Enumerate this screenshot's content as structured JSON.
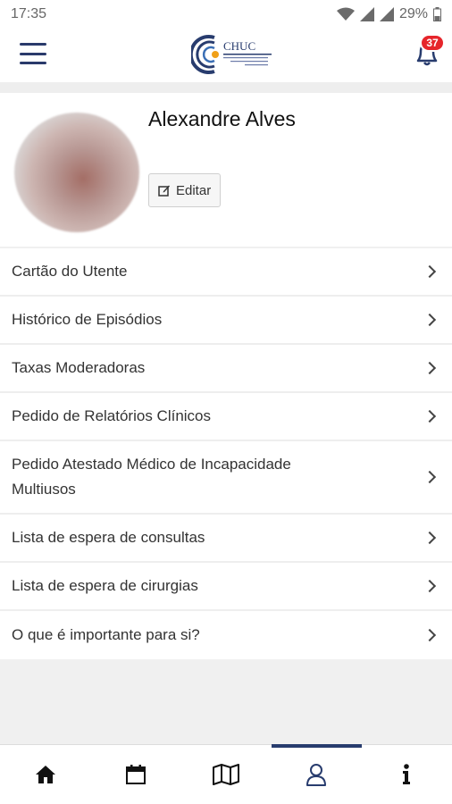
{
  "status_bar": {
    "time": "17:35",
    "battery": "29%"
  },
  "header": {
    "logo_text": "CHUC",
    "logo_subtitle": "CENTRO HOSPITALAR E UNIVERSITÁRIO DE COIMBRA",
    "notification_count": "37"
  },
  "profile": {
    "name": "Alexandre Alves",
    "edit_label": "Editar"
  },
  "menu": {
    "items": [
      {
        "label": "Cartão do Utente"
      },
      {
        "label": "Histórico de Episódios"
      },
      {
        "label": "Taxas Moderadoras"
      },
      {
        "label": "Pedido de Relatórios Clínicos"
      },
      {
        "label": "Pedido Atestado Médico de Incapacidade Multiusos"
      },
      {
        "label": "Lista de espera de consultas"
      },
      {
        "label": "Lista de espera de cirurgias"
      },
      {
        "label": "O que é importante para si?"
      }
    ]
  },
  "bottom_nav": {
    "tabs": [
      {
        "icon": "home-icon"
      },
      {
        "icon": "calendar-icon"
      },
      {
        "icon": "map-icon"
      },
      {
        "icon": "user-icon",
        "active": true
      },
      {
        "icon": "info-icon"
      }
    ]
  },
  "colors": {
    "accent": "#283c6e",
    "badge": "#e6252b",
    "logo_orange": "#f0a018"
  }
}
